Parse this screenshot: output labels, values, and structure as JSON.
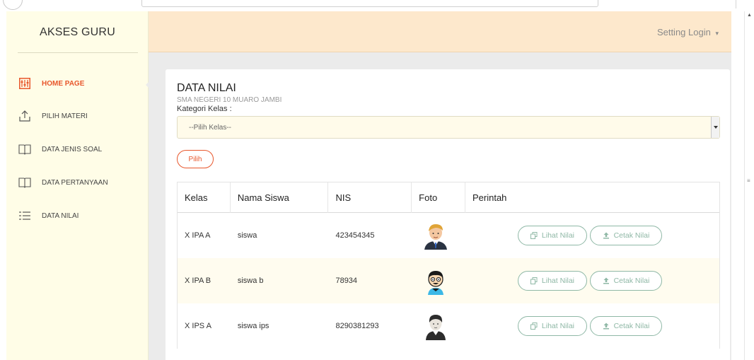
{
  "sidebar": {
    "brand": "AKSES GURU",
    "items": [
      {
        "label": "HOME PAGE",
        "icon": "menu-grid-icon",
        "active": true
      },
      {
        "label": "PILIH MATERI",
        "icon": "upload-icon",
        "active": false
      },
      {
        "label": "DATA JENIS SOAL",
        "icon": "book-icon",
        "active": false
      },
      {
        "label": "DATA PERTANYAAN",
        "icon": "book-icon",
        "active": false
      },
      {
        "label": "DATA NILAI",
        "icon": "list-icon",
        "active": false
      }
    ]
  },
  "header": {
    "setting_label": "Setting Login",
    "setting_caret": "▾"
  },
  "card": {
    "title": "DATA NILAI",
    "subtitle": "SMA NEGERI 10 MUARO JAMBI",
    "kategori_label": "Kategori Kelas :",
    "select_value": "--Pilih Kelas--",
    "pilih_button": "Pilih"
  },
  "table": {
    "headers": [
      "Kelas",
      "Nama Siswa",
      "NIS",
      "Foto",
      "Perintah"
    ],
    "rows": [
      {
        "kelas": "X IPA A",
        "nama": "siswa",
        "nis": "423454345",
        "avatar": "man-blond-avatar"
      },
      {
        "kelas": "X IPA B",
        "nama": "siswa b",
        "nis": "78934",
        "avatar": "cartoon-boy-avatar"
      },
      {
        "kelas": "X IPS A",
        "nama": "siswa ips",
        "nis": "8290381293",
        "avatar": "man-dark-avatar"
      }
    ],
    "lihat_label": "Lihat Nilai",
    "cetak_label": "Cetak Nilai"
  },
  "colors": {
    "accent": "#e8572c",
    "sidebar_bg": "#fffde7",
    "header_bg": "#fde8cc",
    "action_border": "#8fb8a6"
  }
}
